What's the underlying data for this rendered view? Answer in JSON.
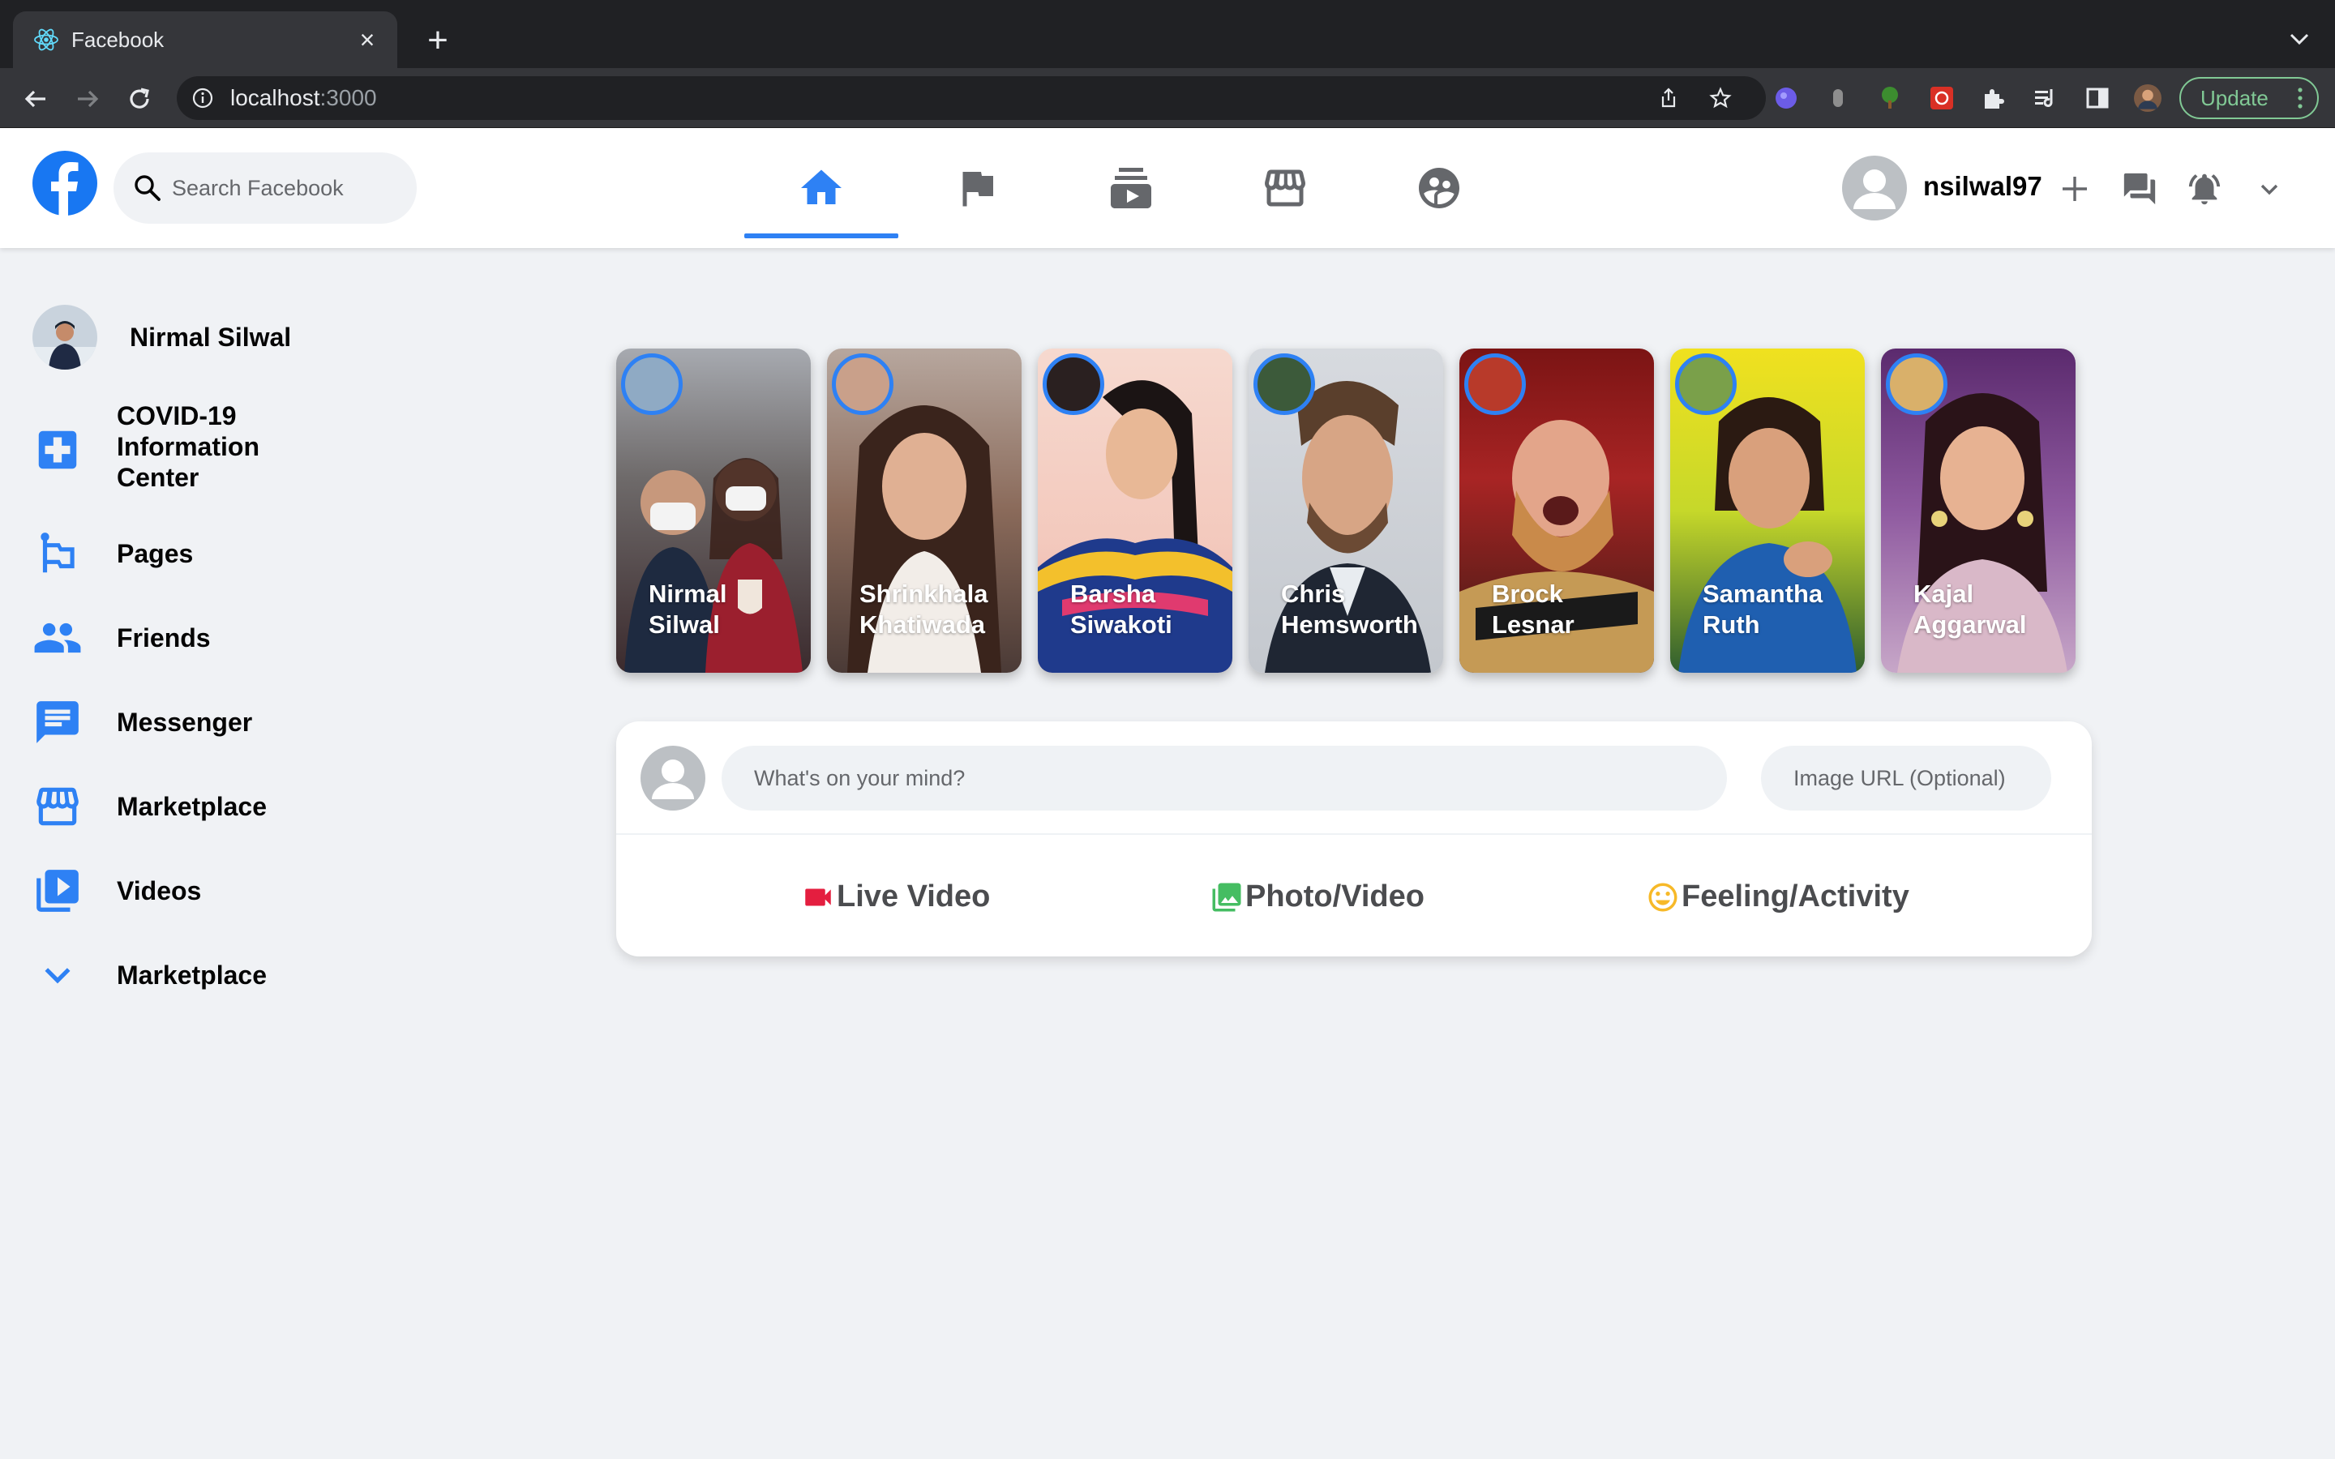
{
  "browser": {
    "tab_title": "Facebook",
    "tab_close": "×",
    "new_tab": "+",
    "url_host": "localhost",
    "url_port": ":3000",
    "update_label": "Update"
  },
  "header": {
    "search_placeholder": "Search Facebook",
    "username": "nsilwal97",
    "nav": [
      "home-icon",
      "flag-icon",
      "subscriptions-icon",
      "storefront-icon",
      "supervised-user-icon"
    ],
    "active_nav": "home",
    "accent_color": "#2e81f4"
  },
  "sidebar": {
    "profile_name": "Nirmal Silwal",
    "items": [
      {
        "label": "COVID-19 Information Center",
        "icon": "local-hospital-icon"
      },
      {
        "label": "Pages",
        "icon": "emoji-flags-icon"
      },
      {
        "label": "Friends",
        "icon": "people-icon"
      },
      {
        "label": "Messenger",
        "icon": "chat-icon"
      },
      {
        "label": "Marketplace",
        "icon": "storefront-icon"
      },
      {
        "label": "Videos",
        "icon": "video-library-icon"
      },
      {
        "label": "Marketplace",
        "icon": "expand-more-icon"
      }
    ]
  },
  "stories": [
    {
      "name": "Nirmal Silwal"
    },
    {
      "name": "Shrinkhala Khatiwada"
    },
    {
      "name": "Barsha Siwakoti"
    },
    {
      "name": "Chris Hemsworth"
    },
    {
      "name": "Brock Lesnar"
    },
    {
      "name": "Samantha Ruth"
    },
    {
      "name": "Kajal Aggarwal"
    }
  ],
  "composer": {
    "message_placeholder": "What's on your mind?",
    "image_placeholder": "Image URL (Optional)",
    "actions": [
      {
        "label": "Live Video",
        "icon": "videocam-icon",
        "color": "#e41e3f"
      },
      {
        "label": "Photo/Video",
        "icon": "photo-library-icon",
        "color": "#45bd62"
      },
      {
        "label": "Feeling/Activity",
        "icon": "insert-emoticon-icon",
        "color": "#f7b928"
      }
    ]
  }
}
